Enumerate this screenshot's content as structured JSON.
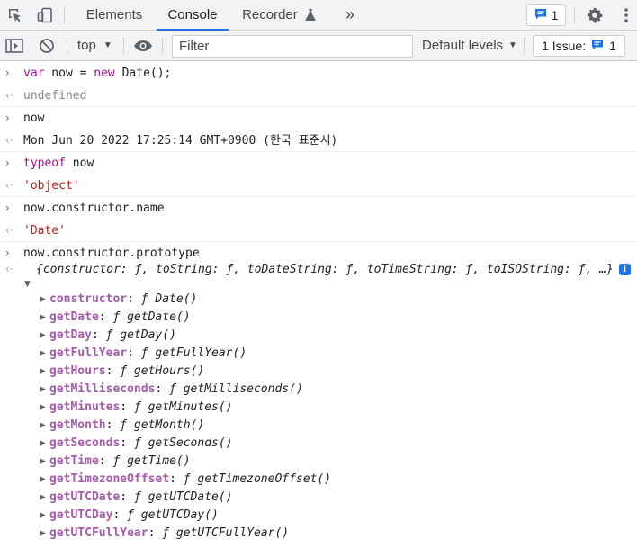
{
  "tabs": {
    "elements": "Elements",
    "console": "Console",
    "recorder": "Recorder",
    "more": "»"
  },
  "messages_badge": {
    "count": "1"
  },
  "toolbar": {
    "context": "top",
    "filter_placeholder": "Filter",
    "levels": "Default levels",
    "issues_label": "1 Issue:",
    "issues_count": "1"
  },
  "console": {
    "lines": [
      {
        "type": "input",
        "parts": [
          [
            "kw",
            "var"
          ],
          [
            "txt",
            " now = "
          ],
          [
            "kw",
            "new"
          ],
          [
            "txt",
            " Date();"
          ]
        ]
      },
      {
        "type": "output",
        "parts": [
          [
            "und",
            "undefined"
          ]
        ]
      },
      {
        "type": "input",
        "parts": [
          [
            "txt",
            "now"
          ]
        ]
      },
      {
        "type": "output",
        "parts": [
          [
            "txt",
            "Mon Jun 20 2022 17:25:14 GMT+0900 (한국 표준시)"
          ]
        ]
      },
      {
        "type": "input",
        "parts": [
          [
            "kw",
            "typeof"
          ],
          [
            "txt",
            " now"
          ]
        ]
      },
      {
        "type": "output",
        "parts": [
          [
            "str",
            "'object'"
          ]
        ]
      },
      {
        "type": "input",
        "parts": [
          [
            "txt",
            "now.constructor.name"
          ]
        ]
      },
      {
        "type": "output",
        "parts": [
          [
            "str",
            "'Date'"
          ]
        ]
      },
      {
        "type": "input",
        "parts": [
          [
            "txt",
            "now.constructor.prototype"
          ]
        ]
      }
    ],
    "object_summary": "{constructor: ƒ, toString: ƒ, toDateString: ƒ, toTimeString: ƒ, toISOString: ƒ, …}",
    "properties": [
      {
        "key": "constructor",
        "value": "ƒ Date()"
      },
      {
        "key": "getDate",
        "value": "ƒ getDate()"
      },
      {
        "key": "getDay",
        "value": "ƒ getDay()"
      },
      {
        "key": "getFullYear",
        "value": "ƒ getFullYear()"
      },
      {
        "key": "getHours",
        "value": "ƒ getHours()"
      },
      {
        "key": "getMilliseconds",
        "value": "ƒ getMilliseconds()"
      },
      {
        "key": "getMinutes",
        "value": "ƒ getMinutes()"
      },
      {
        "key": "getMonth",
        "value": "ƒ getMonth()"
      },
      {
        "key": "getSeconds",
        "value": "ƒ getSeconds()"
      },
      {
        "key": "getTime",
        "value": "ƒ getTime()"
      },
      {
        "key": "getTimezoneOffset",
        "value": "ƒ getTimezoneOffset()"
      },
      {
        "key": "getUTCDate",
        "value": "ƒ getUTCDate()"
      },
      {
        "key": "getUTCDay",
        "value": "ƒ getUTCDay()"
      },
      {
        "key": "getUTCFullYear",
        "value": "ƒ getUTCFullYear()"
      }
    ]
  },
  "icons": {
    "inspect": "inspect-element-icon",
    "device": "device-toolbar-icon",
    "recorder": "flask-icon",
    "messages": "message-icon",
    "settings": "gear-icon",
    "menu": "kebab-menu-icon",
    "sidebar": "sidebar-toggle-icon",
    "clear": "clear-console-icon",
    "eye": "eye-icon"
  },
  "colors": {
    "accent": "#1a73e8",
    "keyword": "#aa0d91",
    "string": "#c41a16",
    "property": "#a55aab"
  }
}
